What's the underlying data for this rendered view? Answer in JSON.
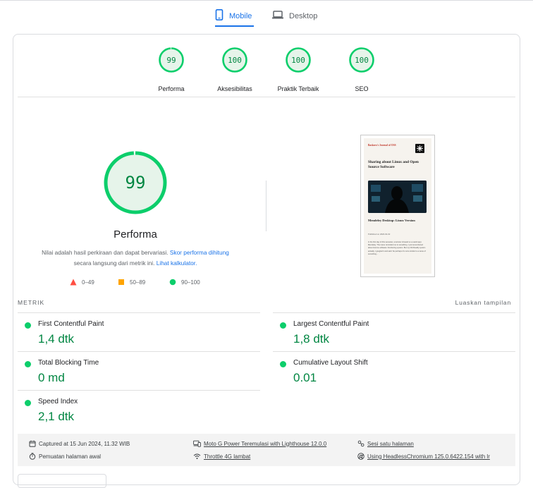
{
  "tabs": [
    {
      "label": "Mobile",
      "icon": "smartphone-icon",
      "active": true
    },
    {
      "label": "Desktop",
      "icon": "laptop-icon",
      "active": false
    }
  ],
  "colors": {
    "pass": "#0cce6b",
    "pass_text": "#018642",
    "pass_bg": "#e6f4ea",
    "average": "#ffa400",
    "fail": "#ff4e42",
    "link": "#1a73e8"
  },
  "categories": [
    {
      "score": "99",
      "label": "Performa",
      "value": 99
    },
    {
      "score": "100",
      "label": "Aksesibilitas",
      "value": 100
    },
    {
      "score": "100",
      "label": "Praktik Terbaik",
      "value": 100
    },
    {
      "score": "100",
      "label": "SEO",
      "value": 100
    }
  ],
  "performance": {
    "score": "99",
    "value": 99,
    "title": "Performa",
    "desc_text": "Nilai adalah hasil perkiraan dan dapat bervariasi.",
    "desc_link1": "Skor performa dihitung",
    "desc_text2": "secara langsung dari metrik ini.",
    "desc_link2": "Lihat kalkulator."
  },
  "legend": [
    {
      "range": "0–49",
      "shape": "triangle-icon"
    },
    {
      "range": "50–89",
      "shape": "square-icon"
    },
    {
      "range": "90–100",
      "shape": "circle-icon"
    }
  ],
  "screenshot": {
    "site_title": "Baskoro's Journal of OSS",
    "headline": "Sharing about Linux and Open Source Software",
    "post_title": "Mendeley Desktop: Linux Version",
    "post_meta": "Published on  2020-02-02",
    "excerpt": "In the first day of this semester, a lecturer showed us a useful app: Mendeley. The name reminded me to something. I just remembered about Gnome software: Numbering system. But my Old Deadly system actually, I googled it and said: So perhaps it's more similar to a name of something..."
  },
  "metrics_header": "METRIK",
  "expand_label": "Luaskan tampilan",
  "metrics": [
    {
      "name": "First Contentful Paint",
      "value": "1,4 dtk"
    },
    {
      "name": "Largest Contentful Paint",
      "value": "1,8 dtk"
    },
    {
      "name": "Total Blocking Time",
      "value": "0 md"
    },
    {
      "name": "Cumulative Layout Shift",
      "value": "0.01"
    },
    {
      "name": "Speed Index",
      "value": "2,1 dtk"
    }
  ],
  "environment": {
    "captured": "Captured at 15 Jun 2024, 11.32 WIB",
    "device": "Moto G Power Teremulasi with Lighthouse 12.0.0",
    "session": "Sesi satu halaman",
    "load": "Pemuatan halaman awal",
    "throttle": "Throttle 4G lambat",
    "browser": "Using HeadlessChromium 125.0.6422.154 with lr"
  }
}
